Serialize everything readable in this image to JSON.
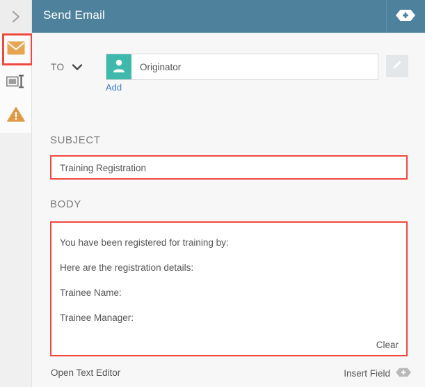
{
  "window": {
    "title": "Send Email"
  },
  "colors": {
    "header_bg": "#4d819c",
    "page_bg": "#f7f7f7",
    "highlight_border": "#f0483e",
    "chip_teal": "#3fb9ab",
    "accent_orange": "#e8a551",
    "link_blue": "#3b7dd8"
  },
  "rail": {
    "toggle_icon": "chevron-right-icon",
    "items": [
      {
        "icon": "envelope-icon",
        "name": "email",
        "selected": true
      },
      {
        "icon": "text-field-icon",
        "name": "text-field",
        "selected": false
      },
      {
        "icon": "warning-triangle-icon",
        "name": "warning",
        "selected": false
      }
    ]
  },
  "header": {
    "title": "Send Email",
    "action_icon": "insert-field-icon"
  },
  "form": {
    "to": {
      "label": "TO",
      "caret_icon": "chevron-down-icon",
      "recipient": "Originator",
      "chip_icon": "person-icon",
      "add_label": "Add",
      "edit_icon": "pencil-icon"
    },
    "subject": {
      "label": "SUBJECT",
      "value": "Training Registration"
    },
    "body": {
      "label": "BODY",
      "lines": [
        "You have been registered for training by:",
        "Here are the registration details:",
        "Trainee Name:",
        "Trainee Manager:"
      ],
      "clear_label": "Clear"
    }
  },
  "footer": {
    "open_text_editor": "Open Text Editor",
    "insert_field": "Insert Field",
    "insert_field_icon": "insert-field-icon"
  },
  "cursor": {
    "icon": "mouse-pointer-icon"
  }
}
